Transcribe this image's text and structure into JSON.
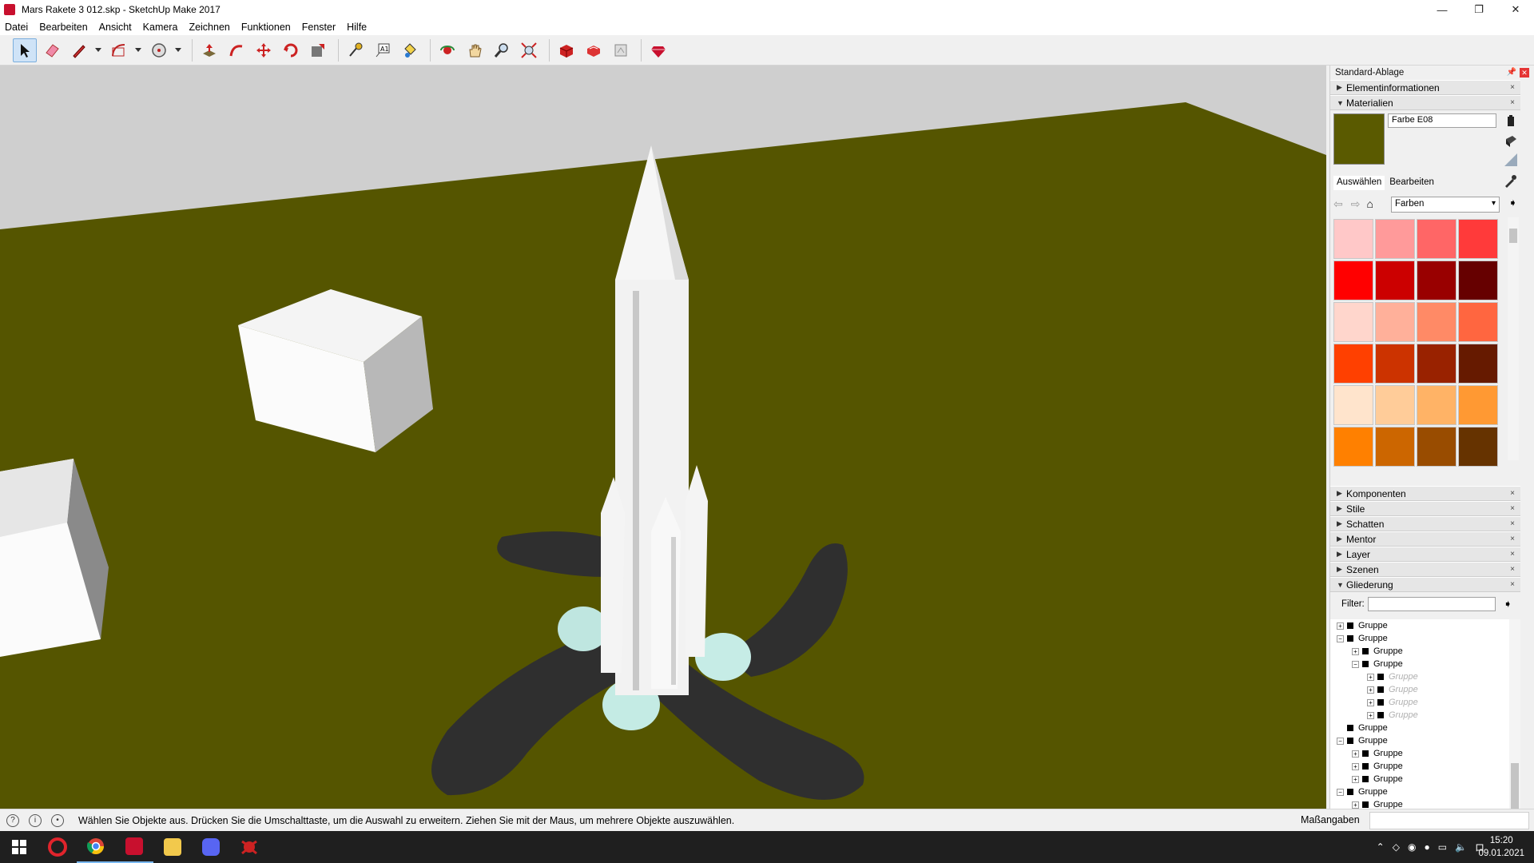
{
  "window": {
    "title": "Mars Rakete 3 012.skp - SketchUp Make 2017",
    "minimize": "—",
    "maximize": "❐",
    "close": "✕"
  },
  "menu": [
    "Datei",
    "Bearbeiten",
    "Ansicht",
    "Kamera",
    "Zeichnen",
    "Funktionen",
    "Fenster",
    "Hilfe"
  ],
  "colors": {
    "ground": "#555500",
    "sky": "#cfcfcf",
    "material_current": "#5a5a00"
  },
  "tray": {
    "title": "Standard-Ablage",
    "panels_top": [
      {
        "label": "Elementinformationen",
        "open": false
      },
      {
        "label": "Materialien",
        "open": true
      }
    ],
    "materials": {
      "name": "Farbe E08",
      "tabs": [
        "Auswählen",
        "Bearbeiten"
      ],
      "library": "Farben",
      "swatches": [
        "#ffc8c8",
        "#ff9a9a",
        "#ff6666",
        "#ff3a3a",
        "#ff0000",
        "#cc0000",
        "#990000",
        "#660000",
        "#ffd6cc",
        "#ffb09a",
        "#ff8a66",
        "#ff6640",
        "#ff4000",
        "#cc3300",
        "#992200",
        "#661a00",
        "#ffe4cc",
        "#ffcc99",
        "#ffb366",
        "#ff9933",
        "#ff8000",
        "#cc6600",
        "#994c00",
        "#663300"
      ]
    },
    "panels_bottom": [
      {
        "label": "Komponenten",
        "open": false
      },
      {
        "label": "Stile",
        "open": false
      },
      {
        "label": "Schatten",
        "open": false
      },
      {
        "label": "Mentor",
        "open": false
      },
      {
        "label": "Layer",
        "open": false
      },
      {
        "label": "Szenen",
        "open": false
      },
      {
        "label": "Gliederung",
        "open": true
      }
    ],
    "outliner": {
      "filter_label": "Filter:",
      "rows": [
        {
          "label": "Gruppe",
          "level": 0,
          "exp": "+",
          "dim": false
        },
        {
          "label": "Gruppe",
          "level": 0,
          "exp": "−",
          "dim": false
        },
        {
          "label": "Gruppe",
          "level": 1,
          "exp": "+",
          "dim": false
        },
        {
          "label": "Gruppe",
          "level": 1,
          "exp": "−",
          "dim": false
        },
        {
          "label": "Gruppe",
          "level": 2,
          "exp": "+",
          "dim": true
        },
        {
          "label": "Gruppe",
          "level": 2,
          "exp": "+",
          "dim": true
        },
        {
          "label": "Gruppe",
          "level": 2,
          "exp": "+",
          "dim": true
        },
        {
          "label": "Gruppe",
          "level": 2,
          "exp": "+",
          "dim": true
        },
        {
          "label": "Gruppe",
          "level": 0,
          "exp": "",
          "dim": false
        },
        {
          "label": "Gruppe",
          "level": 0,
          "exp": "−",
          "dim": false
        },
        {
          "label": "Gruppe",
          "level": 1,
          "exp": "+",
          "dim": false
        },
        {
          "label": "Gruppe",
          "level": 1,
          "exp": "+",
          "dim": false
        },
        {
          "label": "Gruppe",
          "level": 1,
          "exp": "+",
          "dim": false
        },
        {
          "label": "Gruppe",
          "level": 0,
          "exp": "−",
          "dim": false
        },
        {
          "label": "Gruppe",
          "level": 1,
          "exp": "+",
          "dim": false
        },
        {
          "label": "Gruppe",
          "level": 1,
          "exp": "+",
          "dim": false
        },
        {
          "label": "Gruppe",
          "level": 1,
          "exp": "+",
          "dim": false
        }
      ]
    }
  },
  "status": {
    "message": "Wählen Sie Objekte aus. Drücken Sie die Umschalttaste, um die Auswahl zu erweitern. Ziehen Sie mit der Maus, um mehrere Objekte auszuwählen.",
    "measure_label": "Maßangaben"
  },
  "taskbar": {
    "time": "15:20",
    "date": "09.01.2021"
  }
}
